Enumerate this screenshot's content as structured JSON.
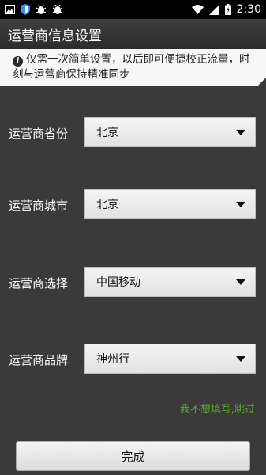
{
  "status_bar": {
    "left_icons": [
      "image-icon",
      "shield-icon",
      "bug-icon",
      "bug-icon"
    ],
    "right_icons": [
      "wifi-icon",
      "signal-icon",
      "battery-charging-icon"
    ],
    "time": "2:30"
  },
  "header": {
    "title": "运营商信息设置"
  },
  "notice": {
    "icon": "info-icon",
    "text": "仅需一次简单设置，以后即可便捷校正流量，时刻与运营商保持精准同步"
  },
  "form": {
    "fields": [
      {
        "label": "运营商省份",
        "value": "北京"
      },
      {
        "label": "运营商城市",
        "value": "北京"
      },
      {
        "label": "运营商选择",
        "value": "中国移动"
      },
      {
        "label": "运营商品牌",
        "value": "神州行"
      }
    ]
  },
  "skip_link": "我不想填写,跳过",
  "done_button": "完成",
  "colors": {
    "accent_green": "#57a82a",
    "background": "#3a3a3a"
  }
}
